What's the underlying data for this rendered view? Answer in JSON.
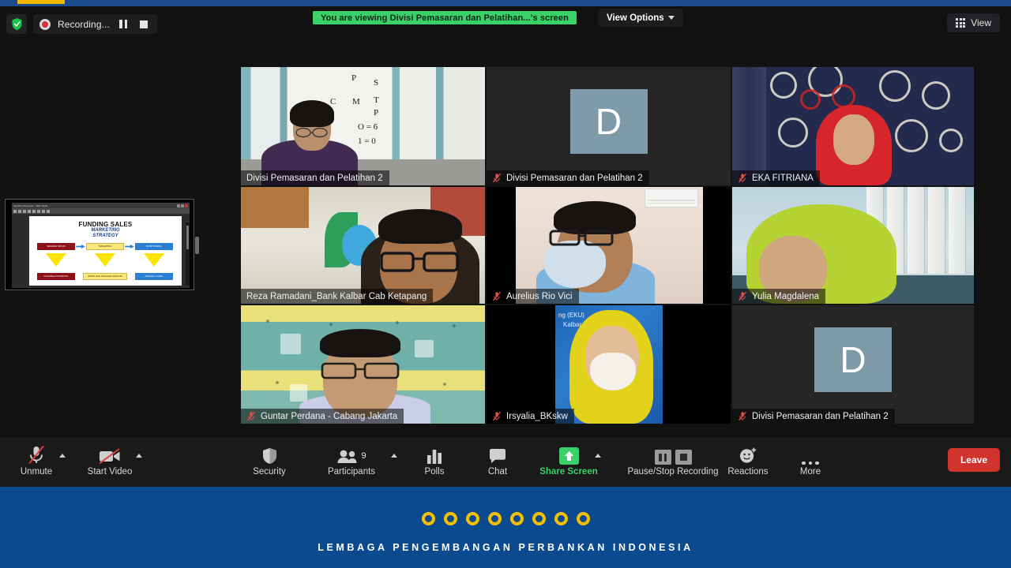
{
  "topbar": {
    "shield_icon": "shield-check-icon",
    "recording_label": "Recording...",
    "recording_dot_icon": "record-dot-icon",
    "pause_icon": "pause-icon",
    "stop_icon": "stop-icon",
    "share_banner_text": "You are viewing Divisi Pemasaran dan Pelatihan...'s screen",
    "view_options_label": "View Options",
    "view_options_caret_icon": "chevron-down-icon",
    "view_button_label": "View",
    "view_grid_icon": "grid-icon",
    "accent_green": "#3ad168",
    "accent_blue": "#1b4b8f",
    "accent_yellow": "#f2b705"
  },
  "shared_screen": {
    "window_title": "Sandbox Presenter - Slide Mode",
    "slide_title": "FUNDING SALES",
    "slide_subtitle_line1": "MARKETING",
    "slide_subtitle_line2": "STRATEGY",
    "flow_top": [
      "SEGMENTATION",
      "TARGETING",
      "POSITIONING"
    ],
    "flow_bottom": [
      "NASABAH PRIORITAS",
      "UMKM DAN PEGAWAI SWASTA",
      "PILIHAN UTAMA"
    ],
    "colors": {
      "red": "#8d0f17",
      "yellow": "#fbe77a",
      "blue": "#2a7fd4",
      "arrow": "#2a7fd4",
      "triangle": "#fde300"
    }
  },
  "participants": [
    {
      "name": "Divisi Pemasaran dan Pelatihan 2",
      "muted": false,
      "active_speaker": true,
      "video_on": true,
      "scene": "whiteboard",
      "whiteboard_marks": [
        "P",
        "S",
        "C",
        "M",
        "T",
        "P",
        "O = 6",
        "1 = 0"
      ]
    },
    {
      "name": "Divisi Pemasaran dan Pelatihan 2",
      "muted": true,
      "active_speaker": false,
      "video_on": false,
      "avatar_letter": "D",
      "avatar_color": "#7f9aa8"
    },
    {
      "name": "EKA FITRIANA",
      "muted": true,
      "active_speaker": false,
      "video_on": true,
      "scene": "batik"
    },
    {
      "name": "Reza Ramadani_Bank Kalbar Cab Ketapang",
      "muted": false,
      "active_speaker": false,
      "video_on": true,
      "scene": "banner"
    },
    {
      "name": "Aurelius Rio Vici",
      "muted": true,
      "active_speaker": false,
      "video_on": true,
      "scene": "room"
    },
    {
      "name": "Yulia Magdalena",
      "muted": true,
      "active_speaker": false,
      "video_on": true,
      "scene": "office"
    },
    {
      "name": "Guntar Perdana - Cabang Jakarta",
      "muted": true,
      "active_speaker": false,
      "video_on": true,
      "scene": "bedsheet"
    },
    {
      "name": "Irsyalia_BKskw",
      "muted": true,
      "active_speaker": false,
      "video_on": true,
      "scene": "bluebg",
      "background_text_line1": "ng (EKU)",
      "background_text_line2": "Kalbar"
    },
    {
      "name": "Divisi Pemasaran dan Pelatihan 2",
      "muted": true,
      "active_speaker": false,
      "video_on": false,
      "avatar_letter": "D",
      "avatar_color": "#7f9aa8"
    }
  ],
  "toolbar": {
    "unmute_label": "Unmute",
    "unmute_icon": "microphone-off-icon",
    "start_video_label": "Start Video",
    "start_video_icon": "video-off-icon",
    "security_label": "Security",
    "security_icon": "shield-icon",
    "participants_label": "Participants",
    "participants_icon": "people-icon",
    "participants_count": "9",
    "polls_label": "Polls",
    "polls_icon": "bar-chart-icon",
    "chat_label": "Chat",
    "chat_icon": "chat-bubble-icon",
    "share_screen_label": "Share Screen",
    "share_screen_icon": "share-arrow-up-icon",
    "recording_label": "Pause/Stop Recording",
    "recording_pause_icon": "pause-icon",
    "recording_stop_icon": "stop-icon",
    "reactions_label": "Reactions",
    "reactions_icon": "smiley-plus-icon",
    "more_label": "More",
    "more_icon": "ellipsis-icon",
    "leave_label": "Leave",
    "leave_color": "#d0342c"
  },
  "footer": {
    "org_name": "LEMBAGA PENGEMBANGAN PERBANKAN INDONESIA",
    "ring_count": 8,
    "ring_color": "#f5c000",
    "background_color": "#0b4a8f"
  }
}
